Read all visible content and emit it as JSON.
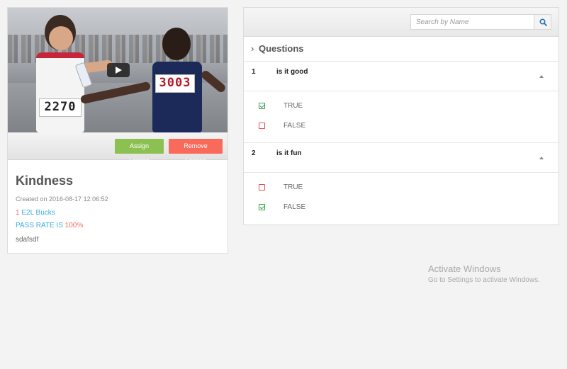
{
  "video": {
    "bibs": [
      "2270",
      "3003"
    ],
    "play_icon": "play-icon"
  },
  "actions": {
    "assign_label": "Assign Lesson",
    "remove_label": "Remove Lesson",
    "assign_color": "#8cc152",
    "remove_color": "#fa6a5a"
  },
  "lesson": {
    "title": "Kindness",
    "created": "Created on 2016-08-17 12:06:52",
    "bucks_count": "1",
    "bucks_label": "E2L Bucks",
    "pass_label": "PASS RATE IS",
    "pass_value": "100%",
    "description": "sdafsdf"
  },
  "search": {
    "placeholder": "Search by Name",
    "icon": "search-icon"
  },
  "questions": {
    "header": "Questions",
    "items": [
      {
        "number": "1",
        "text": "is it good",
        "options": [
          {
            "label": "TRUE",
            "checked": true
          },
          {
            "label": "FALSE",
            "checked": false
          }
        ]
      },
      {
        "number": "2",
        "text": "is it fun",
        "options": [
          {
            "label": "TRUE",
            "checked": false
          },
          {
            "label": "FALSE",
            "checked": true
          }
        ]
      }
    ]
  },
  "watermark": {
    "title": "Activate Windows",
    "subtitle": "Go to Settings to activate Windows."
  },
  "colors": {
    "accent_blue": "#3bafda",
    "accent_red": "#fa6a5a",
    "check_green": "#37a34a",
    "uncheck_red": "#e84b5a"
  }
}
